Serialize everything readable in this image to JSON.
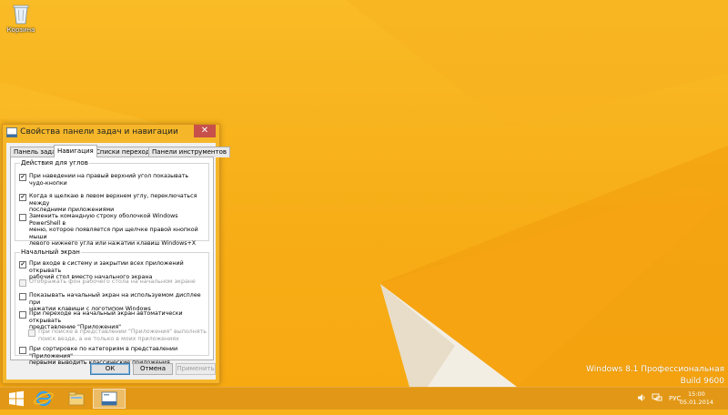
{
  "desktop": {
    "recycle_bin_label": "Корзина",
    "watermark": {
      "line1": "Windows 8.1 Профессиональная",
      "line2": "Build 9600"
    }
  },
  "dialog": {
    "title": "Свойства панели задач и навигации",
    "close_glyph": "✕",
    "tabs": [
      {
        "label": "Панель задач",
        "active": false
      },
      {
        "label": "Навигация",
        "active": true
      },
      {
        "label": "Списки переходов",
        "active": false
      },
      {
        "label": "Панели инструментов",
        "active": false
      }
    ],
    "corners_group": {
      "label": "Действия для углов",
      "options": [
        {
          "text": "При наведении на правый верхний угол показывать\nчудо-кнопки",
          "checked": true,
          "disabled": false
        },
        {
          "text": "Когда я щелкаю в левом верхнем углу, переключаться между\nпоследними приложениями",
          "checked": true,
          "disabled": false
        },
        {
          "text": "Заменить командную строку оболочкой Windows PowerShell в\nменю, которое появляется при щелчке правой кнопкой мыши\nлевого нижнего угла или нажатии клавиш Windows+X",
          "checked": false,
          "disabled": false
        }
      ]
    },
    "start_group": {
      "label": "Начальный экран",
      "options": [
        {
          "text": "При входе в систему и закрытии всех приложений открывать\nрабочий стол вместо начального экрана",
          "checked": true,
          "disabled": false
        },
        {
          "text": "Отображать фон рабочего стола на начальном экране",
          "checked": false,
          "disabled": true
        },
        {
          "text": "Показывать начальный экран на используемом дисплее при\nнажатии клавиши с логотипом Windows",
          "checked": false,
          "disabled": false
        },
        {
          "text": "При переходе на начальный экран автоматически открывать\nпредставление \"Приложения\"",
          "checked": false,
          "disabled": false
        },
        {
          "text": "При поиске в представлении \"Приложения\" выполнять\nпоиск везде, а не только в моих приложениях",
          "checked": false,
          "disabled": true
        },
        {
          "text": "При сортировке по категориям в представлении \"Приложения\"\nпервыми выводить классические приложения",
          "checked": false,
          "disabled": false
        }
      ]
    },
    "buttons": {
      "ok": "ОК",
      "cancel": "Отмена",
      "apply": "Применить"
    }
  },
  "taskbar": {
    "language": "РУС",
    "time": "15:00",
    "date": "05.01.2014",
    "icons": [
      "windows-logo-icon",
      "internet-explorer-icon",
      "file-explorer-icon",
      "taskbar-properties-icon"
    ],
    "tray_icons": [
      "volume-icon",
      "network-icon"
    ]
  },
  "colors": {
    "accent": "#f7b21a",
    "close": "#c7504a"
  }
}
